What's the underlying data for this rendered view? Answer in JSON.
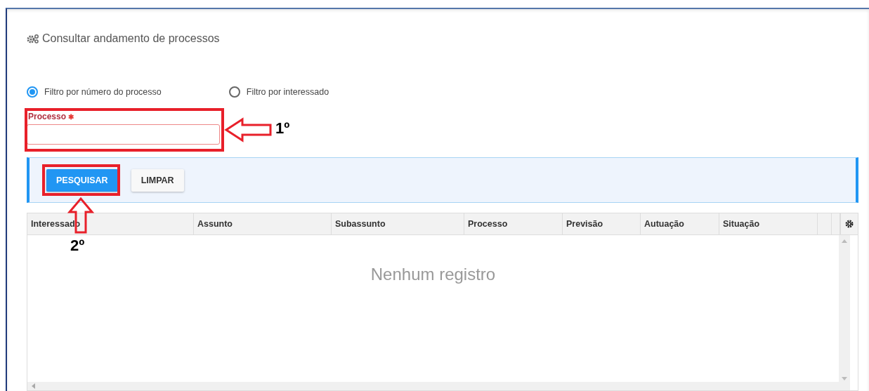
{
  "page": {
    "title": "Consultar andamento de processos"
  },
  "filters": [
    {
      "label": "Filtro por número do processo",
      "selected": true
    },
    {
      "label": "Filtro por interessado",
      "selected": false
    }
  ],
  "field": {
    "label": "Processo",
    "required_mark": "✱"
  },
  "buttons": [
    {
      "label": "PESQUISAR",
      "kind": "primary"
    },
    {
      "label": "LIMPAR",
      "kind": "secondary"
    }
  ],
  "table": {
    "columns": [
      "Interessado",
      "Assunto",
      "Subassunto",
      "Processo",
      "Previsão",
      "Autuação",
      "Situação"
    ],
    "empty_message": "Nenhum registro"
  },
  "annotations": [
    {
      "label": "1º",
      "kind": "leftarrow"
    },
    {
      "label": "2º",
      "kind": "uparrow"
    }
  ]
}
